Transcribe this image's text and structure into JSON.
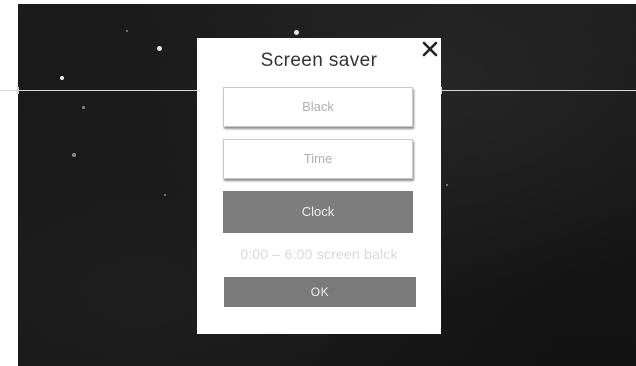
{
  "dialog": {
    "title": "Screen saver",
    "close_icon": "close-icon",
    "options": [
      {
        "label": "Black",
        "selected": false
      },
      {
        "label": "Time",
        "selected": false
      },
      {
        "label": "Clock",
        "selected": true
      }
    ],
    "hint": "0:00 – 6:00 screen balck",
    "ok_label": "OK"
  },
  "colors": {
    "background": "#161616",
    "dialog": "#ffffff",
    "selected_option": "#7d7d7d",
    "ok_button": "#7a7a7a",
    "hint_text": "#d8d8d8"
  }
}
